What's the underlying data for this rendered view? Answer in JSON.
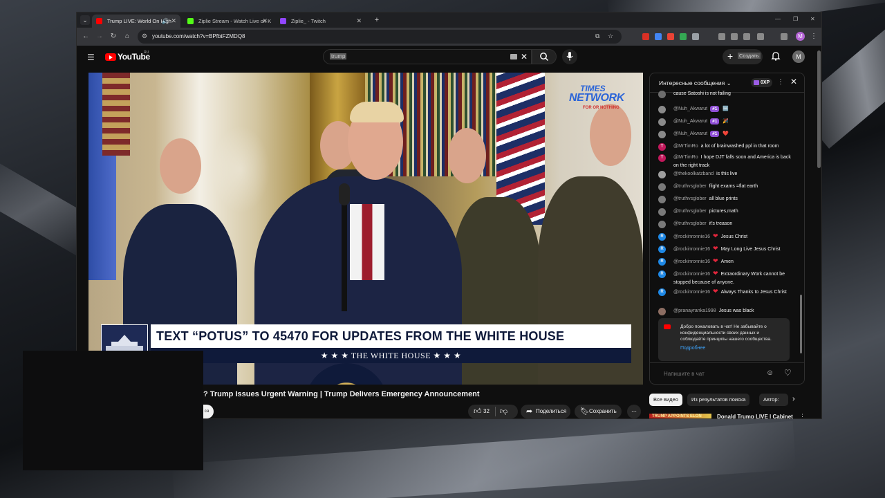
{
  "browser": {
    "tabs": [
      {
        "title": "Trump LIVE: World On High",
        "active": true,
        "favicon_color": "#ff0000"
      },
      {
        "title": "Ziplie Stream - Watch Live on K",
        "active": false,
        "favicon_color": "#53fc18"
      },
      {
        "title": "Ziplie_ - Twitch",
        "active": false,
        "favicon_color": "#9146ff"
      }
    ],
    "url": "youtube.com/watch?v=BPfbtFZMDQ8"
  },
  "youtube": {
    "logo_text": "YouTube",
    "country_code": "RU",
    "search_value": "trump",
    "create_label": "Создать",
    "account_initial": "M"
  },
  "video": {
    "watermark": {
      "line1": "TIMES",
      "line2": "NETWORK",
      "line3": "FOR OR NOTHING"
    },
    "lower_third": "TEXT “POTUS” TO 45470 FOR UPDATES FROM THE WHITE HOUSE",
    "lower_third_sub": "★ ★ ★   THE WHITE HOUSE   ★ ★ ★",
    "title": "? Trump Issues Urgent Warning | Trump Delivers Emergency Announcement",
    "subscribe_stub": "ся",
    "like_count": "32",
    "share_label": "Поделиться",
    "save_label": "Сохранить"
  },
  "chat": {
    "header_title": "Интересные сообщения",
    "xp_label": "0XP",
    "messages": [
      {
        "author": "",
        "text": "cause Satoshi is not failing",
        "avatar_color": "#6d6d6d",
        "avatar_letter": "",
        "badge": ""
      },
      {
        "author": "@Nuh_Akwarut",
        "text": "🆒",
        "avatar_color": "#8a8a8a",
        "avatar_letter": "",
        "badge": "#1"
      },
      {
        "author": "@Nuh_Akwarut",
        "text": "🎉",
        "avatar_color": "#8a8a8a",
        "avatar_letter": "",
        "badge": "#1"
      },
      {
        "author": "@Nuh_Akwarut",
        "text": "❤️",
        "avatar_color": "#8a8a8a",
        "avatar_letter": "",
        "badge": "#1"
      },
      {
        "author": "@MrTimRo",
        "text": "a lot of brainwashed ppl in that room",
        "avatar_color": "#c2185b",
        "avatar_letter": "T",
        "badge": ""
      },
      {
        "author": "@MrTimRo",
        "text": "I hope DJT falls soon and America is back on the right track",
        "avatar_color": "#c2185b",
        "avatar_letter": "T",
        "badge": ""
      },
      {
        "author": "@thekoolkatzband",
        "text": "is this live",
        "avatar_color": "#9e9e9e",
        "avatar_letter": "",
        "badge": ""
      },
      {
        "author": "@truthvsglober",
        "text": "flight exams =flat earth",
        "avatar_color": "#7a7a7a",
        "avatar_letter": "",
        "badge": ""
      },
      {
        "author": "@truthvsglober",
        "text": "all blue prints",
        "avatar_color": "#7a7a7a",
        "avatar_letter": "",
        "badge": ""
      },
      {
        "author": "@truthvsglober",
        "text": "pictures,math",
        "avatar_color": "#7a7a7a",
        "avatar_letter": "",
        "badge": ""
      },
      {
        "author": "@truthvsglober",
        "text": "it's treason",
        "avatar_color": "#7a7a7a",
        "avatar_letter": "",
        "badge": ""
      },
      {
        "author": "@rockinronnie16",
        "text": "Jesus Christ",
        "avatar_color": "#1e88e5",
        "avatar_letter": "R",
        "badge": "",
        "heart": true
      },
      {
        "author": "@rockinronnie16",
        "text": "May Long Live Jesus Christ",
        "avatar_color": "#1e88e5",
        "avatar_letter": "R",
        "badge": "",
        "heart": true
      },
      {
        "author": "@rockinronnie16",
        "text": "Amen",
        "avatar_color": "#1e88e5",
        "avatar_letter": "R",
        "badge": "",
        "heart": true
      },
      {
        "author": "@rockinronnie16",
        "text": "Extraordinary Work cannot be stopped because of anyone.",
        "avatar_color": "#1e88e5",
        "avatar_letter": "R",
        "badge": "",
        "heart": true
      },
      {
        "author": "@rockinronnie16",
        "text": "Always Thanks to Jesus Christ",
        "avatar_color": "#1e88e5",
        "avatar_letter": "R",
        "badge": "",
        "heart": true
      },
      {
        "author": "@pranayranka1998",
        "text": "Jesus was black",
        "avatar_color": "#8d6e63",
        "avatar_letter": "",
        "badge": ""
      }
    ],
    "welcome_text": "Добро пожаловать в чат! Не забывайте о конфиденциальности своих данных и соблюдайте принципы нашего сообщества.",
    "welcome_link": "Подробнее",
    "input_placeholder": "Напишите в чат"
  },
  "related": {
    "chips": [
      "Все видео",
      "Из результатов поиска",
      "Автор: "
    ],
    "first_title": "Donald Trump LIVE | Cabinet",
    "first_thumb_text": "TRUMP APPOINTS ELON"
  }
}
